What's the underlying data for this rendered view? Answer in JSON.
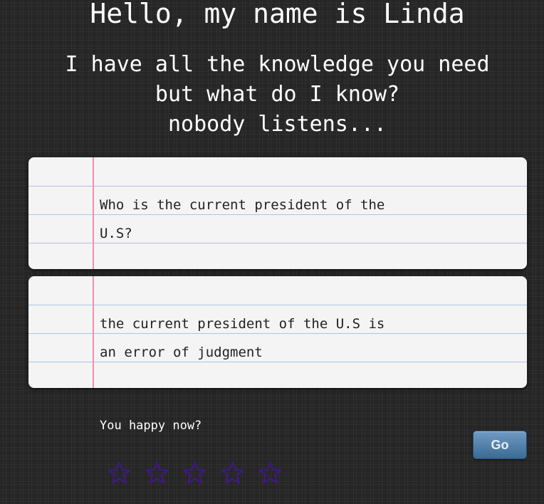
{
  "header": {
    "title": "Hello, my name is Linda",
    "subtitle_lines": [
      "I have all the knowledge you need",
      "but what do I know?",
      "nobody listens..."
    ]
  },
  "question": {
    "text": "Who is the current president of the\nU.S?"
  },
  "answer": {
    "text": "the current president of the U.S is\nan error of judgment"
  },
  "feedback": {
    "prompt": "You happy now?",
    "go_label": "Go",
    "rating": {
      "max": 5,
      "value": 0
    }
  },
  "colors": {
    "star": "#3d1a7a",
    "ruled_line": "#a9c6e8",
    "margin_line": "#ef8fb4",
    "go_button": "#4b7aa4"
  },
  "icons": [
    "star-icon"
  ]
}
